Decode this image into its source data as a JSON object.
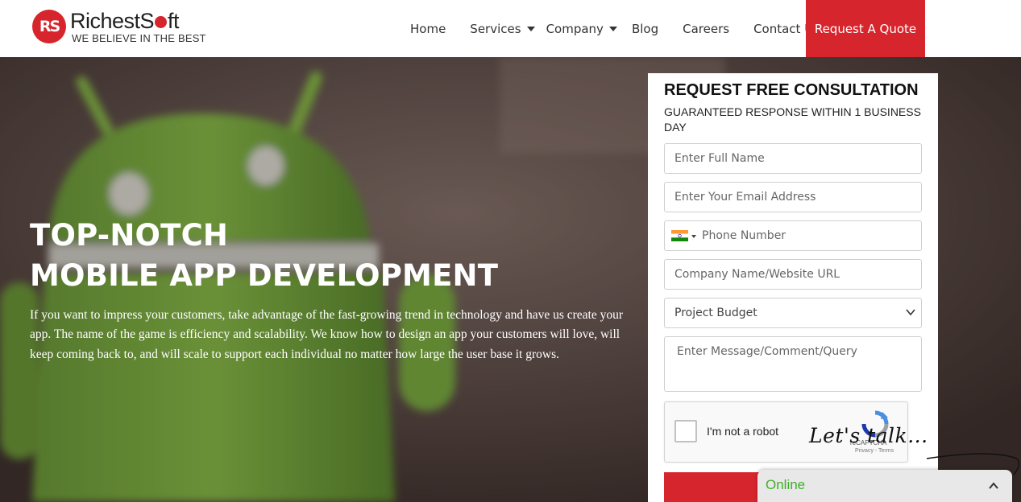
{
  "brand": {
    "logo_mark": "RS",
    "name_part1": "RichestS",
    "name_part2": "ft",
    "tagline": "WE BELIEVE IN THE BEST"
  },
  "nav": {
    "items": [
      {
        "label": "Home",
        "has_dropdown": false
      },
      {
        "label": "Services",
        "has_dropdown": true
      },
      {
        "label": "Company",
        "has_dropdown": true
      },
      {
        "label": "Blog",
        "has_dropdown": false
      },
      {
        "label": "Careers",
        "has_dropdown": false
      },
      {
        "label": "Contact Us",
        "has_dropdown": false
      }
    ],
    "cta_label": "Request A Quote"
  },
  "hero": {
    "title_line1": "TOP-NOTCH",
    "title_line2": "MOBILE APP DEVELOPMENT",
    "description": "If you want to impress your customers, take advantage of the fast-growing trend in technology and have us create your app. The name of the game is efficiency and scalability. We know how to design an app your customers will love, will keep coming back to, and will scale to support each individual no matter how large the user base it grows."
  },
  "form": {
    "title": "REQUEST FREE CONSULTATION",
    "subtitle": "GUARANTEED RESPONSE WITHIN 1 BUSINESS DAY",
    "full_name_placeholder": "Enter Full Name",
    "email_placeholder": "Enter Your Email Address",
    "phone_placeholder": "Phone Number",
    "phone_country_icon": "india-flag-icon",
    "company_placeholder": "Company Name/Website URL",
    "budget_selected": "Project Budget",
    "message_placeholder": "Enter Message/Comment/Query",
    "captcha_label": "I'm not a robot",
    "captcha_brand": "reCAPTCHA",
    "captcha_links": "Privacy - Terms"
  },
  "chat": {
    "lets_talk": "Let's talk...",
    "status": "Online"
  },
  "colors": {
    "accent_red": "#d6252d",
    "online_green": "#3fae2a",
    "android_green": "#7cb342"
  }
}
